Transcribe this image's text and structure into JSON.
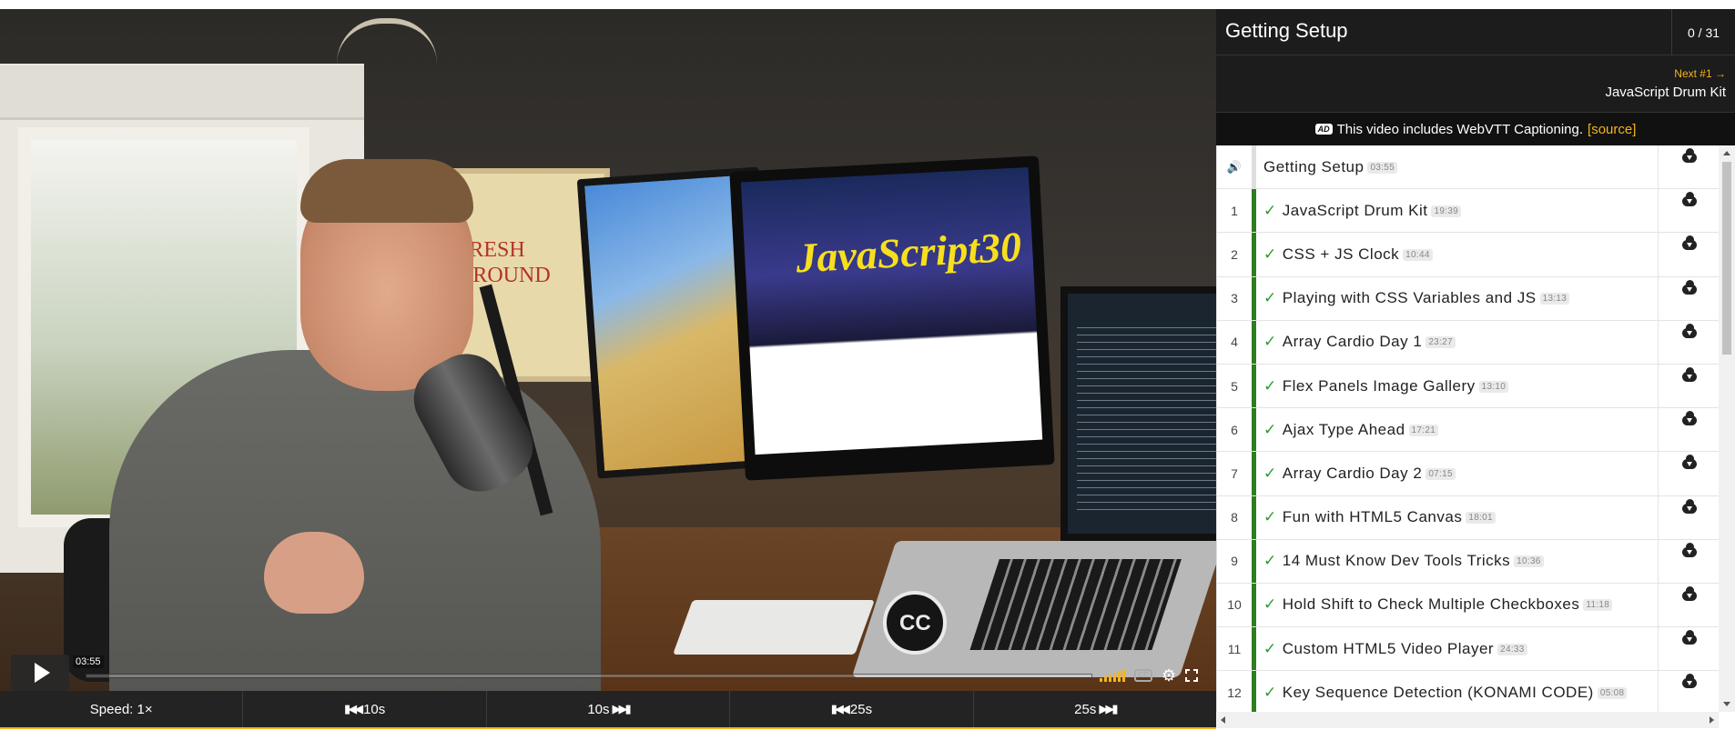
{
  "player": {
    "current_time": "03:55",
    "speed_bar": [
      {
        "label": "Speed: 1×",
        "icon": ""
      },
      {
        "label": "10s",
        "icon": "skip-back-icon"
      },
      {
        "label": "10s",
        "icon": "skip-forward-icon"
      },
      {
        "label": "25s",
        "icon": "skip-back-icon"
      },
      {
        "label": "25s",
        "icon": "skip-forward-icon"
      }
    ],
    "icons": [
      "volume-icon",
      "closed-captions-icon",
      "gear-icon",
      "fullscreen-icon"
    ],
    "accent": "#f3b51c",
    "scene_text": {
      "poster": "FRESH GROUND",
      "screen": "JavaScript30",
      "badge": "CC"
    }
  },
  "sidebar": {
    "title": "Getting Setup",
    "progress": "0 / 31",
    "next": {
      "label": "Next #1 →",
      "title": "JavaScript Drum Kit"
    },
    "caption": {
      "badge": "AD",
      "text": "This video includes WebVTT Captioning.",
      "link": "[source]"
    },
    "lessons": [
      {
        "num": "",
        "title": "Getting Setup",
        "duration": "03:55",
        "done": false,
        "current": true
      },
      {
        "num": "1",
        "title": "JavaScript Drum Kit",
        "duration": "19:39",
        "done": true
      },
      {
        "num": "2",
        "title": "CSS + JS Clock",
        "duration": "10:44",
        "done": true
      },
      {
        "num": "3",
        "title": "Playing with CSS Variables and JS",
        "duration": "13:13",
        "done": true
      },
      {
        "num": "4",
        "title": "Array Cardio Day 1",
        "duration": "23:27",
        "done": true
      },
      {
        "num": "5",
        "title": "Flex Panels Image Gallery",
        "duration": "13:10",
        "done": true
      },
      {
        "num": "6",
        "title": "Ajax Type Ahead",
        "duration": "17:21",
        "done": true
      },
      {
        "num": "7",
        "title": "Array Cardio Day 2",
        "duration": "07:15",
        "done": true
      },
      {
        "num": "8",
        "title": "Fun with HTML5 Canvas",
        "duration": "18:01",
        "done": true
      },
      {
        "num": "9",
        "title": "14 Must Know Dev Tools Tricks",
        "duration": "10:36",
        "done": true
      },
      {
        "num": "10",
        "title": "Hold Shift to Check Multiple Checkboxes",
        "duration": "11:18",
        "done": true
      },
      {
        "num": "11",
        "title": "Custom HTML5 Video Player",
        "duration": "24:33",
        "done": true
      },
      {
        "num": "12",
        "title": "Key Sequence Detection (KONAMI CODE)",
        "duration": "05:08",
        "done": true
      }
    ]
  }
}
